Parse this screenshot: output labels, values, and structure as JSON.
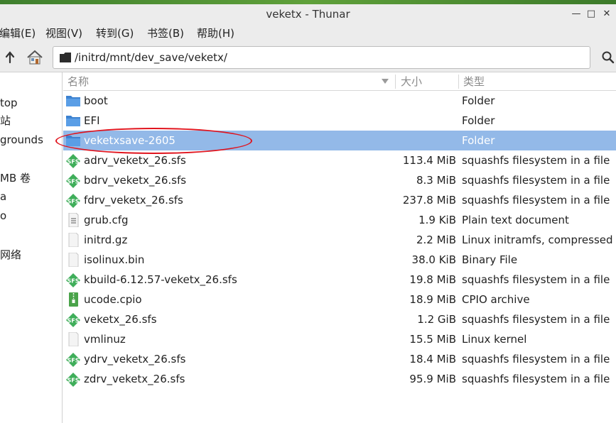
{
  "window": {
    "title": "veketx - Thunar"
  },
  "menubar": [
    "编辑(E)",
    "视图(V)",
    "转到(G)",
    "书签(B)",
    "帮助(H)"
  ],
  "location": {
    "path": "/initrd/mnt/dev_save/veketx/"
  },
  "sidebar": {
    "items": [
      "top",
      "站",
      "grounds",
      "MB 卷",
      "a",
      "o",
      "网络"
    ]
  },
  "columns": {
    "name": "名称",
    "size": "大小",
    "type": "类型"
  },
  "files": [
    {
      "name": "boot",
      "size": "",
      "type": "Folder",
      "icon": "folder-icon"
    },
    {
      "name": "EFI",
      "size": "",
      "type": "Folder",
      "icon": "folder-icon"
    },
    {
      "name": "veketxsave-2605",
      "size": "",
      "type": "Folder",
      "icon": "folder-icon",
      "selected": true
    },
    {
      "name": "adrv_veketx_26.sfs",
      "size": "113.4 MiB",
      "type": "squashfs filesystem in a file",
      "icon": "sfs-icon"
    },
    {
      "name": "bdrv_veketx_26.sfs",
      "size": "8.3 MiB",
      "type": "squashfs filesystem in a file",
      "icon": "sfs-icon"
    },
    {
      "name": "fdrv_veketx_26.sfs",
      "size": "237.8 MiB",
      "type": "squashfs filesystem in a file",
      "icon": "sfs-icon"
    },
    {
      "name": "grub.cfg",
      "size": "1.9 KiB",
      "type": "Plain text document",
      "icon": "text-file-icon"
    },
    {
      "name": "initrd.gz",
      "size": "2.2 MiB",
      "type": "Linux initramfs, compressed",
      "icon": "blank-file-icon"
    },
    {
      "name": "isolinux.bin",
      "size": "38.0 KiB",
      "type": "Binary File",
      "icon": "blank-file-icon"
    },
    {
      "name": "kbuild-6.12.57-veketx_26.sfs",
      "size": "19.8 MiB",
      "type": "squashfs filesystem in a file",
      "icon": "sfs-icon"
    },
    {
      "name": "ucode.cpio",
      "size": "18.9 MiB",
      "type": "CPIO archive",
      "icon": "archive-icon"
    },
    {
      "name": "veketx_26.sfs",
      "size": "1.2 GiB",
      "type": "squashfs filesystem in a file",
      "icon": "sfs-icon"
    },
    {
      "name": "vmlinuz",
      "size": "15.5 MiB",
      "type": "Linux kernel",
      "icon": "blank-file-icon"
    },
    {
      "name": "ydrv_veketx_26.sfs",
      "size": "18.4 MiB",
      "type": "squashfs filesystem in a file",
      "icon": "sfs-icon"
    },
    {
      "name": "zdrv_veketx_26.sfs",
      "size": "95.9 MiB",
      "type": "squashfs filesystem in a file",
      "icon": "sfs-icon"
    }
  ],
  "icons": {
    "sfs_label": "SFS"
  },
  "colors": {
    "selection": "#93b9e8",
    "annotation": "#e0141e",
    "folder": "#4a90d9",
    "sfs": "#3fae5a"
  }
}
